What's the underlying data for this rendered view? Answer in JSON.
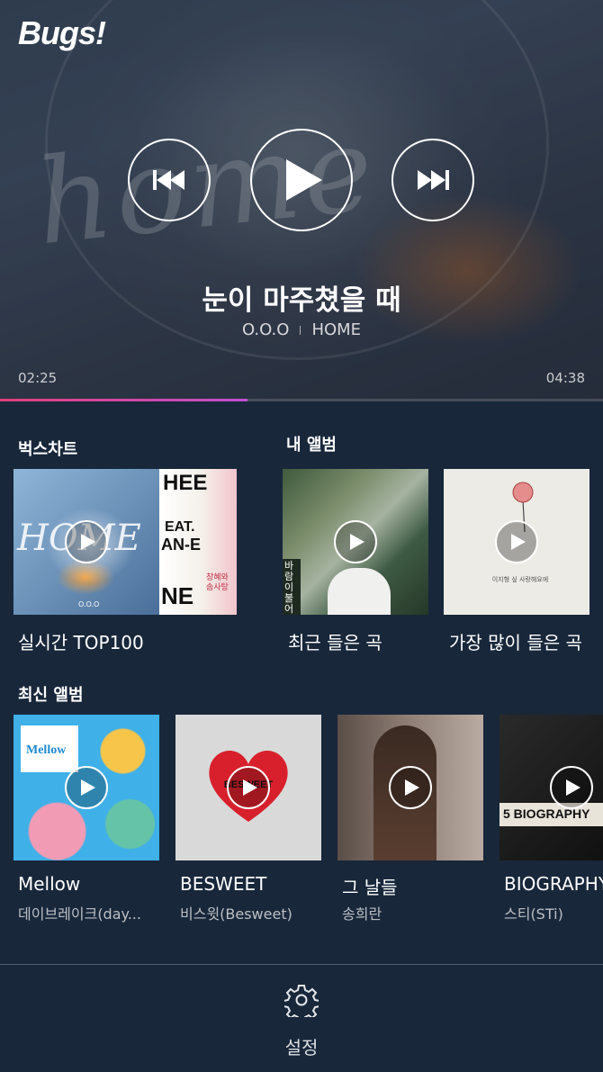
{
  "app": {
    "logo": "Bugs!"
  },
  "player": {
    "title": "눈이 마주쳤을 때",
    "artist": "O.O.O",
    "album": "HOME",
    "artwork_text": "home",
    "current_time": "02:25",
    "total_time": "04:38",
    "progress": 0.41,
    "progress_color": "#d94a9a"
  },
  "sections": {
    "chart": {
      "title": "벅스차트",
      "items": [
        {
          "label": "실시간 TOP100",
          "art": [
            "HOME",
            "HEE",
            "EAT.",
            "AN-E",
            "NE",
            "창혜와 솜사탕",
            "O.O.O"
          ]
        }
      ]
    },
    "my_album": {
      "title": "내 앨범",
      "items": [
        {
          "label": "최근 들은 곡",
          "art_text": "바람이 불어오네"
        },
        {
          "label": "가장 많이 들은 곡",
          "art_text": "이지형 싶 사랑해요에"
        }
      ]
    },
    "new_albums": {
      "title": "최신 앨범",
      "items": [
        {
          "label": "Mellow",
          "sub": "데이브레이크(day...",
          "art_text": "Mellow"
        },
        {
          "label": "BESWEET",
          "sub": "비스윗(Besweet)",
          "art_text": "BESWEET"
        },
        {
          "label": "그 날들",
          "sub": "송희란"
        },
        {
          "label": "BIOGRAPHY",
          "sub": "스티(STi)",
          "art_text": "5 BIOGRAPHY"
        }
      ]
    }
  },
  "bottom": {
    "settings_label": "설정",
    "settings_icon": "gear-icon"
  }
}
